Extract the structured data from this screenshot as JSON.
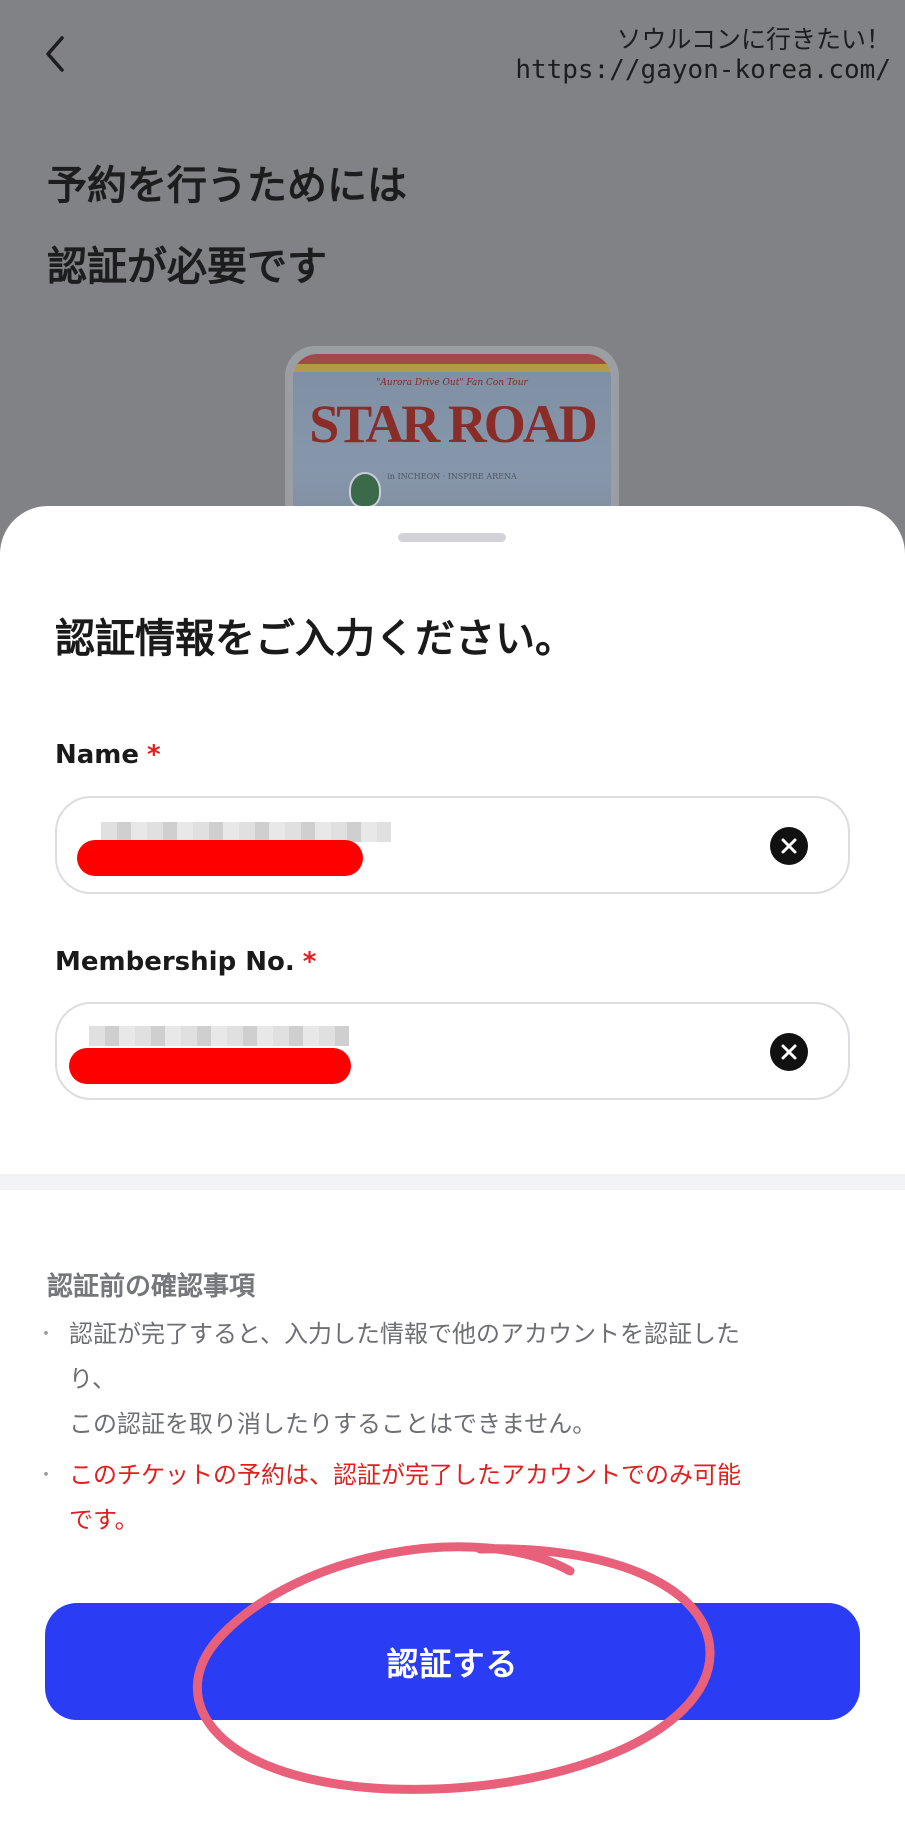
{
  "watermark": {
    "line1": "ソウルコンに行きたい！",
    "line2": "https://gayon-korea.com/"
  },
  "page": {
    "heading_line1": "予約を行うためには",
    "heading_line2": "認証が必要です"
  },
  "poster": {
    "subtitle": "\"Aurora Drive Out\" Fan Con Tour",
    "title": "STAR ROAD",
    "venue": "in INCHEON · INSPIRE ARENA"
  },
  "sheet": {
    "title": "認証情報をご入力ください。",
    "name_label": "Name",
    "member_label": "Membership No.",
    "required_mark": "*",
    "name_value": "",
    "member_value": "",
    "notice_title": "認証前の確認事項",
    "notice_1_line1": "認証が完了すると、入力した情報で他のアカウントを認証した",
    "notice_1_line2": "り、",
    "notice_1_line3": "この認証を取り消したりすることはできません。",
    "notice_2_line1": "このチケットの予約は、認証が完了したアカウントでのみ可能",
    "notice_2_line2": "です。",
    "submit_label": "認証する"
  },
  "colors": {
    "accent": "#2a3df4",
    "warning": "#e02020",
    "overlay": "#818285",
    "redaction": "#ff0000",
    "annotation": "#e8607a"
  },
  "icons": {
    "back": "chevron-left-icon",
    "clear": "close-circle-icon"
  }
}
